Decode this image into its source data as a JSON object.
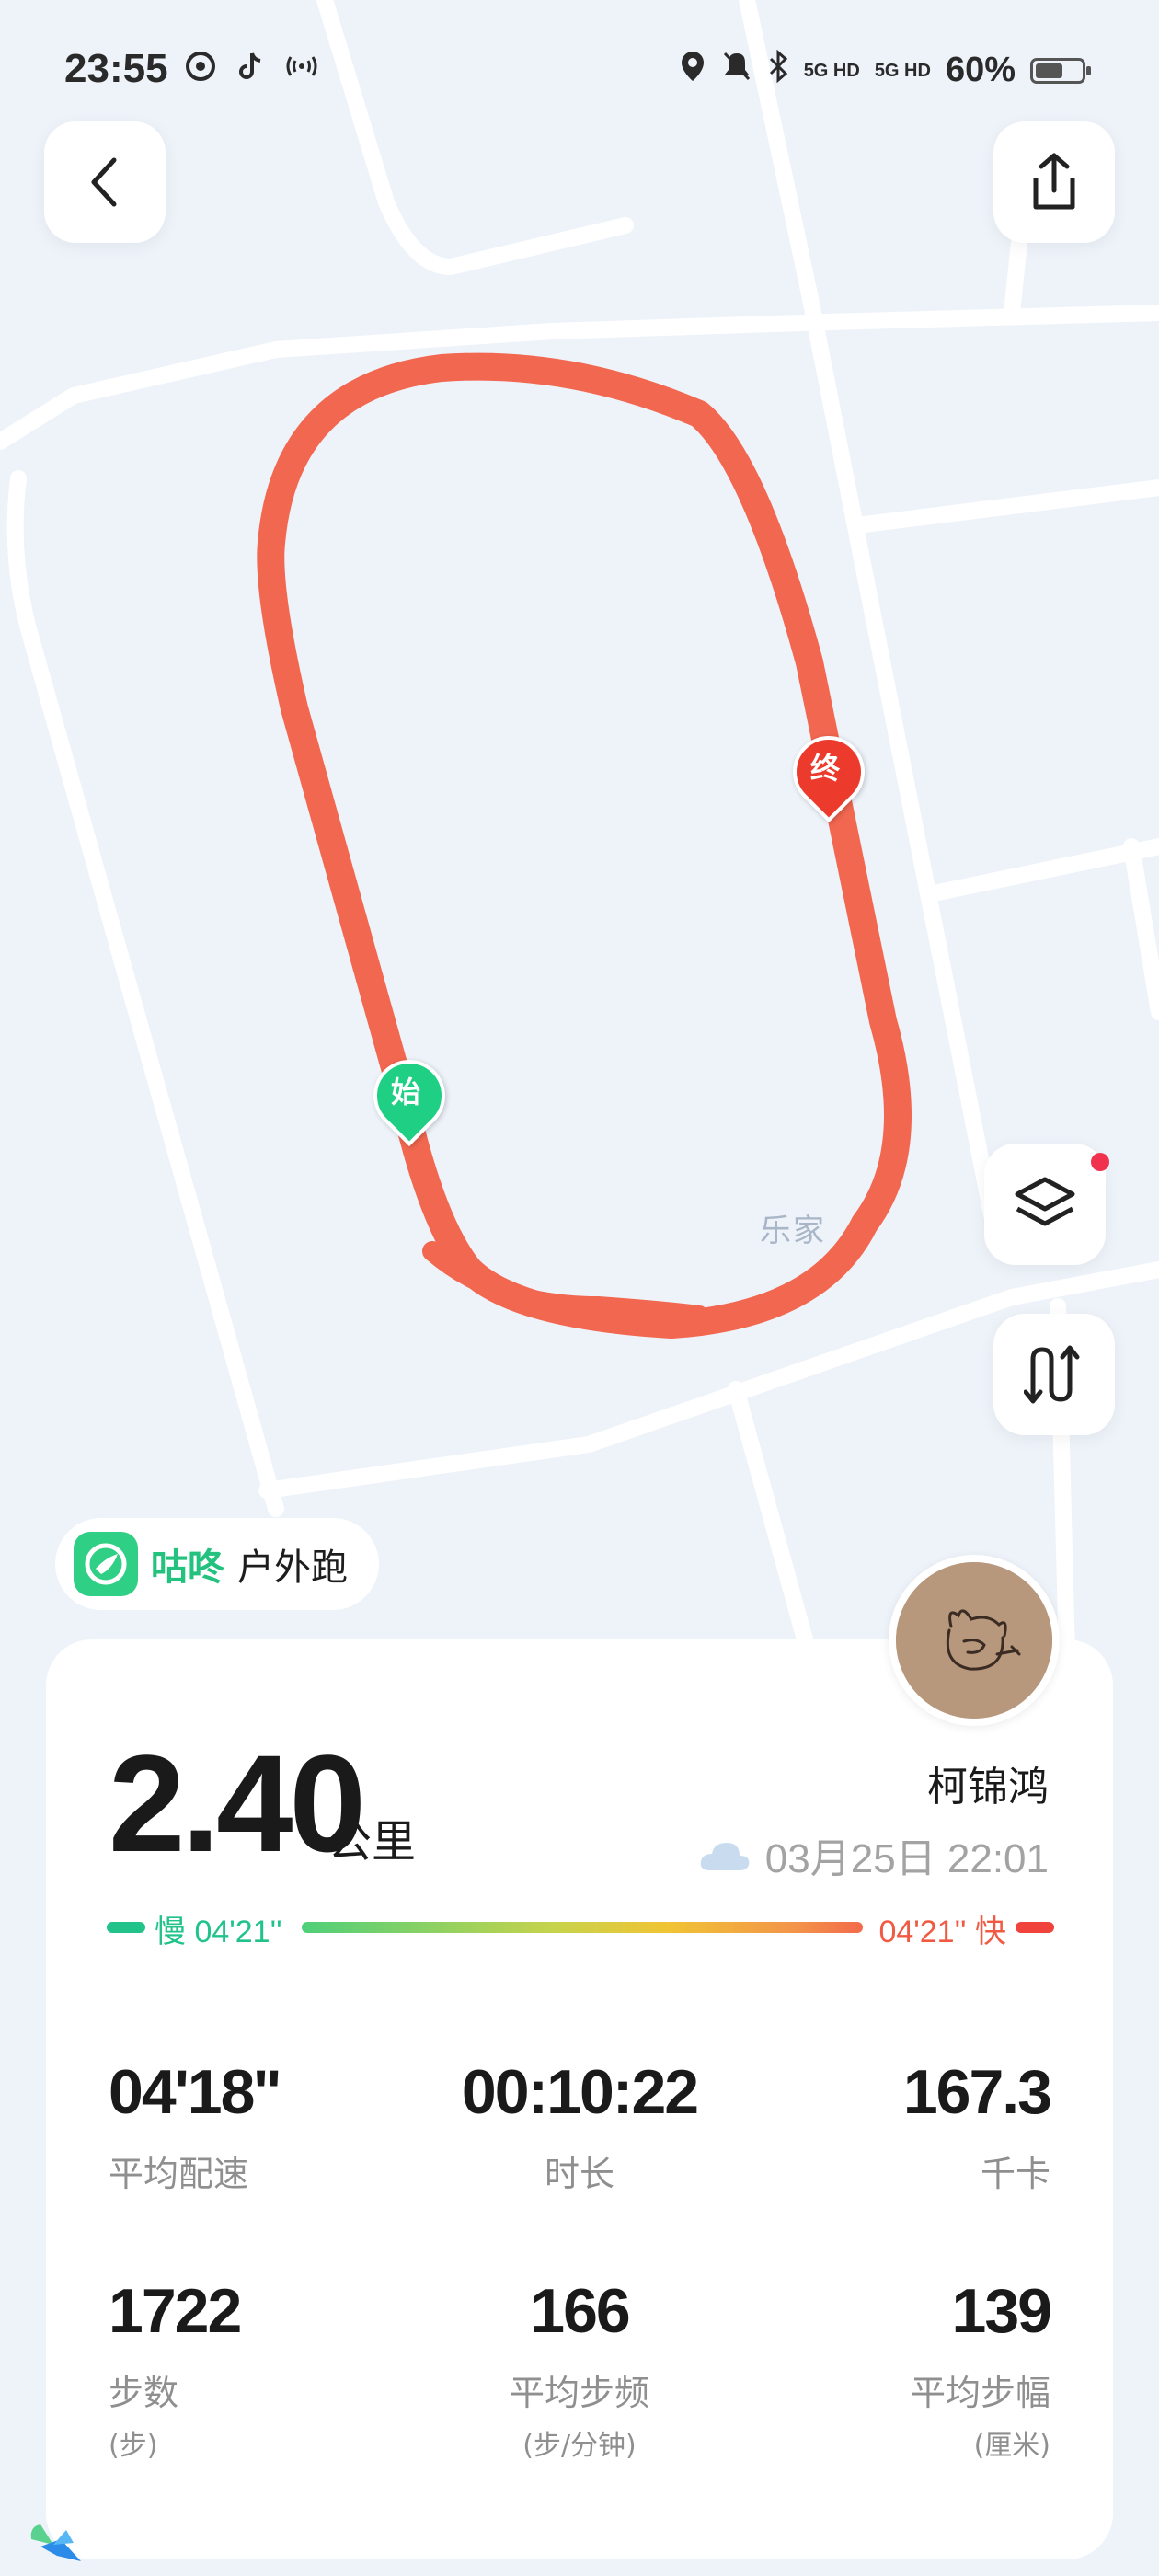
{
  "status_bar": {
    "time": "23:55",
    "battery_percent": "60%",
    "battery_level": 0.6,
    "signal_1": "5G HD",
    "signal_2": "5G HD"
  },
  "map": {
    "start_marker": "始",
    "end_marker": "终",
    "place_label": "乐家",
    "route_color": "#f26750"
  },
  "app": {
    "name": "咕咚",
    "mode": "户外跑"
  },
  "user": {
    "name": "柯锦鸿"
  },
  "workout": {
    "distance": "2.40",
    "distance_unit": "公里",
    "date_time": "03月25日 22:01",
    "weather_icon": "cloud-icon",
    "pace_slow_label": "慢 04'21''",
    "pace_fast_label": "04'21'' 快",
    "stats": [
      {
        "value": "04'18''",
        "label": "平均配速",
        "unit": ""
      },
      {
        "value": "00:10:22",
        "label": "时长",
        "unit": ""
      },
      {
        "value": "167.3",
        "label": "千卡",
        "unit": ""
      },
      {
        "value": "1722",
        "label": "步数",
        "unit": "(步)"
      },
      {
        "value": "166",
        "label": "平均步频",
        "unit": "(步/分钟)"
      },
      {
        "value": "139",
        "label": "平均步幅",
        "unit": "(厘米)"
      }
    ]
  },
  "colors": {
    "accent_green": "#23c27e",
    "accent_red": "#f0433c",
    "background": "#eef3fa"
  }
}
